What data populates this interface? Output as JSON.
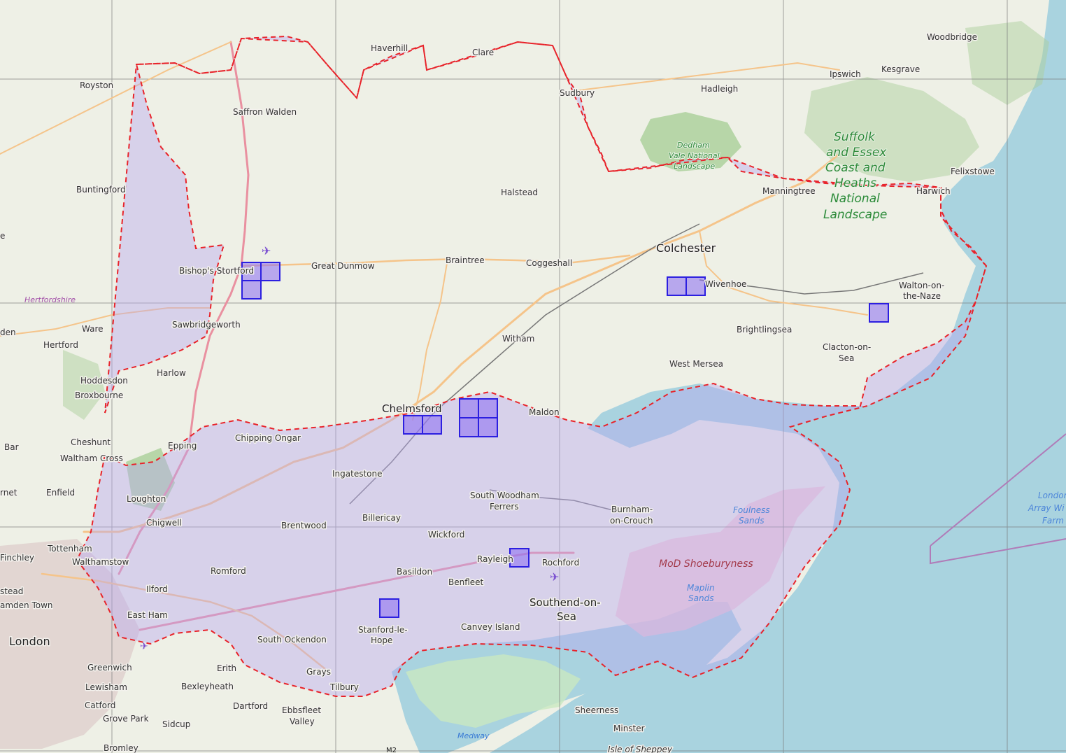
{
  "map": {
    "colors": {
      "land": "#eef0e6",
      "sea": "#a9d3df",
      "region_fill": "#b8a8f0",
      "region_outline": "#e8232a",
      "square_fill": "#8a6cf2",
      "square_stroke": "#2c1fe0",
      "grid": "#7b7b7b",
      "motorway": "#e990a0",
      "primary_road": "#f5c48a",
      "woodland": "#add19e",
      "mudflat": "#c9e8c0",
      "military": "#f2c6d0"
    },
    "labels": {
      "haverhill": "Haverhill",
      "clare": "Clare",
      "woodbridge": "Woodbridge",
      "royston": "Royston",
      "sudbury": "Sudbury",
      "hadleigh": "Hadleigh",
      "ipswich": "Ipswich",
      "kesgrave": "Kesgrave",
      "saffron_walden": "Saffron Walden",
      "dedham_l1": "Dedham",
      "dedham_l2": "Vale National",
      "dedham_l3": "Landscape",
      "suffolk_l1": "Suffolk",
      "suffolk_l2": "and Essex",
      "suffolk_l3": "Coast and",
      "suffolk_l4": "Heaths",
      "suffolk_l5": "National",
      "suffolk_l6": "Landscape",
      "felixstowe": "Felixstowe",
      "buntingford": "Buntingford",
      "halstead": "Halstead",
      "manningtree": "Manningtree",
      "harwich": "Harwich",
      "colchester": "Colchester",
      "bishops_stortford": "Bishop's Stortford",
      "great_dunmow": "Great Dunmow",
      "braintree": "Braintree",
      "coggeshall": "Coggeshall",
      "wivenhoe": "Wivenhoe",
      "walton_l1": "Walton-on-",
      "walton_l2": "the-Naze",
      "hertfordshire": "Hertfordshire",
      "sawbridgeworth": "Sawbridgeworth",
      "ware": "Ware",
      "hertford": "Hertford",
      "witham": "Witham",
      "brightlingsea": "Brightlingsea",
      "clacton_l1": "Clacton-on-",
      "clacton_l2": "Sea",
      "west_mersea": "West Mersea",
      "harlow": "Harlow",
      "hoddesdon": "Hoddesdon",
      "broxbourne": "Broxbourne",
      "chelmsford": "Chelmsford",
      "maldon": "Maldon",
      "bar": "Bar",
      "cheshunt": "Cheshunt",
      "chipping_ongar": "Chipping Ongar",
      "epping": "Epping",
      "waltham_cross": "Waltham Cross",
      "ingatestone": "Ingatestone",
      "enfield": "Enfield",
      "south_woodham_l1": "South Woodham",
      "south_woodham_l2": "Ferrers",
      "loughton": "Loughton",
      "burnham_l1": "Burnham-",
      "burnham_l2": "on-Crouch",
      "foulness_l1": "Foulness",
      "foulness_l2": "Sands",
      "billericay": "Billericay",
      "chigwell": "Chigwell",
      "brentwood": "Brentwood",
      "london_array_l1": "London",
      "london_array_l2": "Array Wi",
      "london_array_l3": "Farm",
      "tottenham": "Tottenham",
      "wickford": "Wickford",
      "rayleigh": "Rayleigh",
      "finchley": "Finchley",
      "walthamstow": "Walthamstow",
      "romford": "Romford",
      "mod_shoeburyness": "MoD Shoeburyness",
      "rochford": "Rochford",
      "basildon": "Basildon",
      "benfleet": "Benfleet",
      "ilford": "Ilford",
      "maplin_l1": "Maplin",
      "maplin_l2": "Sands",
      "stead": "stead",
      "camden_town": "amden Town",
      "southend_l1": "Southend-on-",
      "southend_l2": "Sea",
      "east_ham": "East Ham",
      "canvey_island": "Canvey Island",
      "stanford_l1": "Stanford-le-",
      "stanford_l2": "Hope",
      "london": "London",
      "south_ockendon": "South Ockendon",
      "greenwich": "Greenwich",
      "erith": "Erith",
      "grays": "Grays",
      "lewisham": "Lewisham",
      "bexleyheath": "Bexleyheath",
      "tilbury": "Tilbury",
      "dartford": "Dartford",
      "catford": "Catford",
      "ebbsfleet_l1": "Ebbsfleet",
      "ebbsfleet_l2": "Valley",
      "sheerness": "Sheerness",
      "grove_park": "Grove Park",
      "sidcup": "Sidcup",
      "minster": "Minster",
      "medway": "Medway",
      "bromley": "Bromley",
      "m2": "M2",
      "isle_of_sheppey": "Isle of Sheppey",
      "rnet": "rnet",
      "den": "den",
      "e": "e"
    }
  }
}
